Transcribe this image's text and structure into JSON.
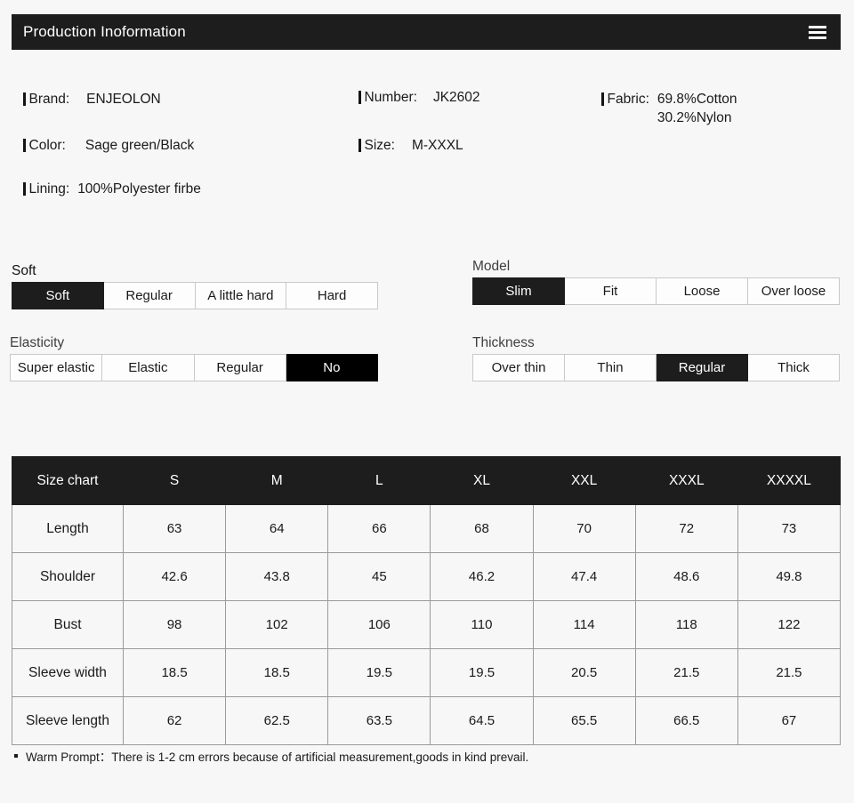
{
  "header": {
    "title": "Production Inoformation",
    "menu_icon": "hamburger-icon"
  },
  "info": {
    "brand": {
      "label": "Brand:",
      "value": "ENJEOLON"
    },
    "color": {
      "label": "Color:",
      "value": "Sage green/Black"
    },
    "lining": {
      "label": "Lining:",
      "value": "100%Polyester firbe"
    },
    "number": {
      "label": "Number:",
      "value": "JK2602"
    },
    "size": {
      "label": "Size:",
      "value": "M-XXXL"
    },
    "fabric": {
      "label": "Fabric:",
      "value": "69.8%Cotton\n30.2%Nylon"
    }
  },
  "attributes": {
    "softness": {
      "heading": "Soft",
      "options": [
        "Soft",
        "Regular",
        "A little hard",
        "Hard"
      ],
      "selected": "Soft"
    },
    "elasticity": {
      "heading": "Elasticity",
      "options": [
        "Super elastic",
        "Elastic",
        "Regular",
        "No"
      ],
      "selected": "No"
    },
    "model": {
      "heading": "Model",
      "options": [
        "Slim",
        "Fit",
        "Loose",
        "Over loose"
      ],
      "selected": "Slim"
    },
    "thickness": {
      "heading": "Thickness",
      "options": [
        "Over thin",
        "Thin",
        "Regular",
        "Thick"
      ],
      "selected": "Regular"
    }
  },
  "size_chart": {
    "columns": [
      "Size chart",
      "S",
      "M",
      "L",
      "XL",
      "XXL",
      "XXXL",
      "XXXXL"
    ],
    "rows": [
      {
        "label": "Length",
        "values": [
          "63",
          "64",
          "66",
          "68",
          "70",
          "72",
          "73"
        ]
      },
      {
        "label": "Shoulder",
        "values": [
          "42.6",
          "43.8",
          "45",
          "46.2",
          "47.4",
          "48.6",
          "49.8"
        ]
      },
      {
        "label": "Bust",
        "values": [
          "98",
          "102",
          "106",
          "110",
          "114",
          "118",
          "122"
        ]
      },
      {
        "label": "Sleeve width",
        "values": [
          "18.5",
          "18.5",
          "19.5",
          "19.5",
          "20.5",
          "21.5",
          "21.5"
        ]
      },
      {
        "label": "Sleeve length",
        "values": [
          "62",
          "62.5",
          "63.5",
          "64.5",
          "65.5",
          "66.5",
          "67"
        ]
      }
    ]
  },
  "note": {
    "text": "Warm Prompt：There is 1-2 cm errors because of artificial measurement,goods in kind prevail."
  },
  "colors": {
    "page_background": "#f7f7f7",
    "header_background": "#1d1d1d",
    "selected_background": "#1d1d1d",
    "table_header_background": "#1d1d1d",
    "text": "#1a1a1a",
    "border": "#9a9a9a"
  }
}
